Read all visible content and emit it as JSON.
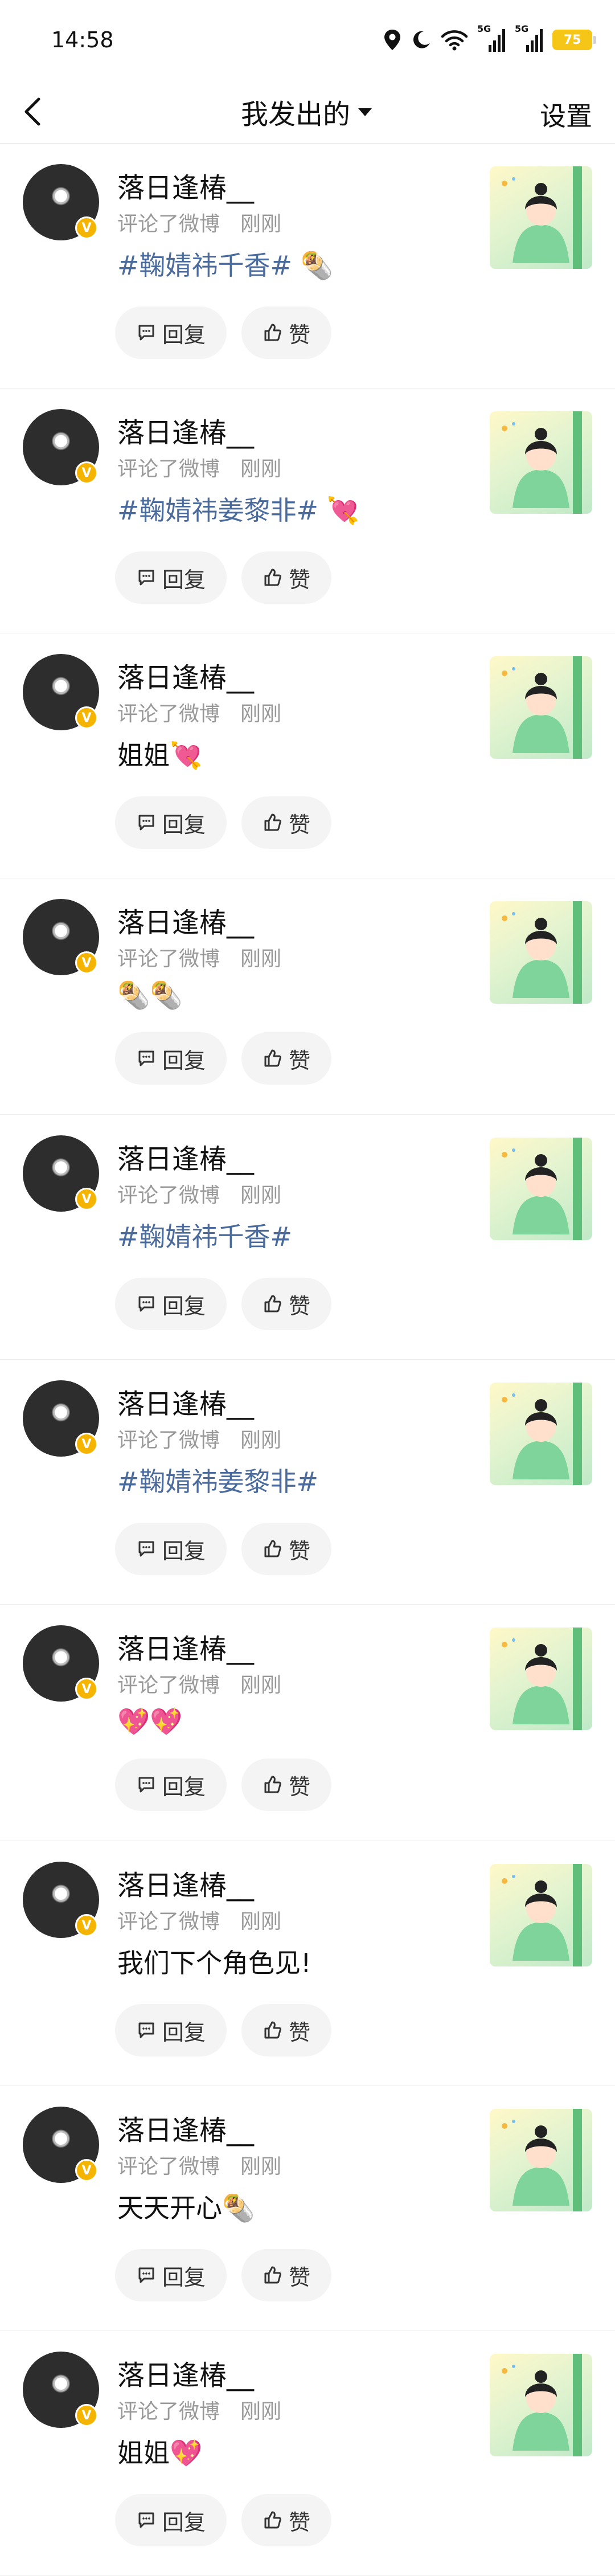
{
  "status": {
    "time": "14:58",
    "signal_label_1": "5G",
    "signal_label_2": "5G",
    "battery": "75"
  },
  "header": {
    "title": "我发出的",
    "settings": "设置"
  },
  "labels": {
    "reply": "回复",
    "like": "赞"
  },
  "comments": [
    {
      "username": "落日逢椿__",
      "action": "评论了微博",
      "time": "刚刚",
      "content": "#鞠婧祎千香# 🌯"
    },
    {
      "username": "落日逢椿__",
      "action": "评论了微博",
      "time": "刚刚",
      "content": "#鞠婧祎姜黎非# 💘"
    },
    {
      "username": "落日逢椿__",
      "action": "评论了微博",
      "time": "刚刚",
      "content": "姐姐💘"
    },
    {
      "username": "落日逢椿__",
      "action": "评论了微博",
      "time": "刚刚",
      "content": "🌯🌯"
    },
    {
      "username": "落日逢椿__",
      "action": "评论了微博",
      "time": "刚刚",
      "content": "#鞠婧祎千香#"
    },
    {
      "username": "落日逢椿__",
      "action": "评论了微博",
      "time": "刚刚",
      "content": "#鞠婧祎姜黎非#"
    },
    {
      "username": "落日逢椿__",
      "action": "评论了微博",
      "time": "刚刚",
      "content": "💖💖"
    },
    {
      "username": "落日逢椿__",
      "action": "评论了微博",
      "time": "刚刚",
      "content": "我们下个角色见!"
    },
    {
      "username": "落日逢椿__",
      "action": "评论了微博",
      "time": "刚刚",
      "content": "天天开心🌯"
    },
    {
      "username": "落日逢椿__",
      "action": "评论了微博",
      "time": "刚刚",
      "content": "姐姐💖"
    }
  ]
}
